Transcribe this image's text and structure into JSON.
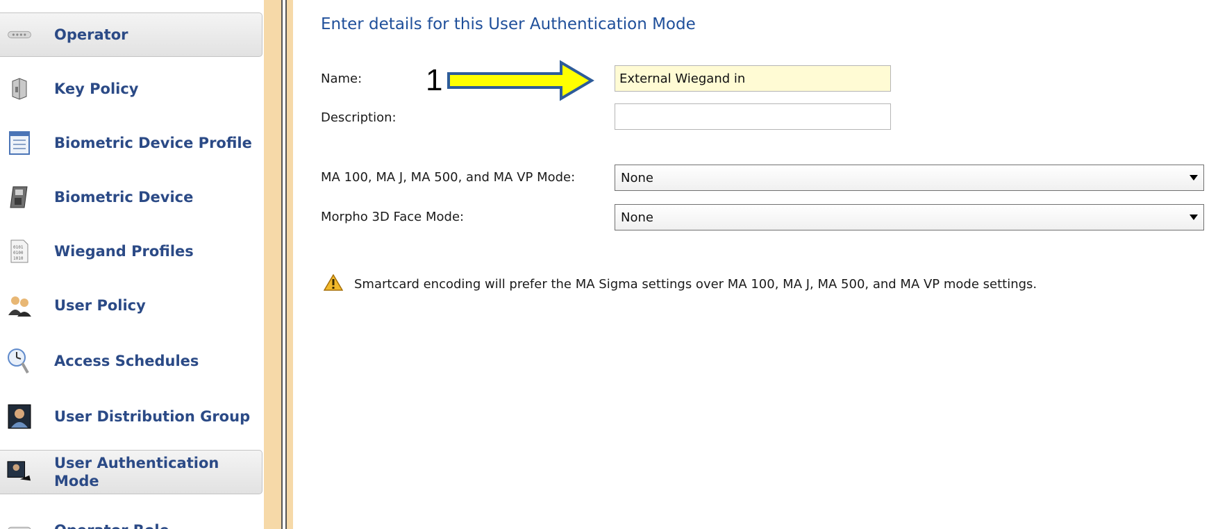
{
  "sidebar": {
    "items": [
      {
        "label": "Operator",
        "icon": "operator-icon",
        "active": true
      },
      {
        "label": "Key Policy",
        "icon": "key-policy-icon",
        "active": false
      },
      {
        "label": "Biometric Device Profile",
        "icon": "device-profile-icon",
        "active": false
      },
      {
        "label": "Biometric Device",
        "icon": "biometric-device-icon",
        "active": false
      },
      {
        "label": "Wiegand Profiles",
        "icon": "wiegand-file-icon",
        "active": false
      },
      {
        "label": "User Policy",
        "icon": "user-policy-icon",
        "active": false
      },
      {
        "label": "Access Schedules",
        "icon": "access-schedules-icon",
        "active": false
      },
      {
        "label": "User Distribution Group",
        "icon": "user-distribution-icon",
        "active": false
      },
      {
        "label": "User Authentication Mode",
        "icon": "user-authentication-icon",
        "active": true
      },
      {
        "label": "Operator Role",
        "icon": "operator-role-icon",
        "active": false
      }
    ]
  },
  "main": {
    "heading": "Enter details for this User Authentication Mode",
    "name_label": "Name:",
    "name_value": "External Wiegand in",
    "description_label": "Description:",
    "description_value": "",
    "ma_mode_label": "MA 100, MA J, MA 500, and MA VP Mode:",
    "ma_mode_value": "None",
    "face_mode_label": "Morpho 3D Face Mode:",
    "face_mode_value": "None",
    "warning_text": "Smartcard encoding will prefer the MA Sigma settings over MA 100, MA J, MA 500, and MA VP mode settings."
  },
  "annotation": {
    "number": "1",
    "arrow_color": "#ffff00",
    "arrow_outline": "#2e5c9a"
  },
  "colors": {
    "background": "#f6d9a8",
    "sidebar_text": "#2b4a86",
    "heading": "#1f4f9a",
    "filled_input": "#fffbd4",
    "warning_icon": "#f2b92b"
  }
}
